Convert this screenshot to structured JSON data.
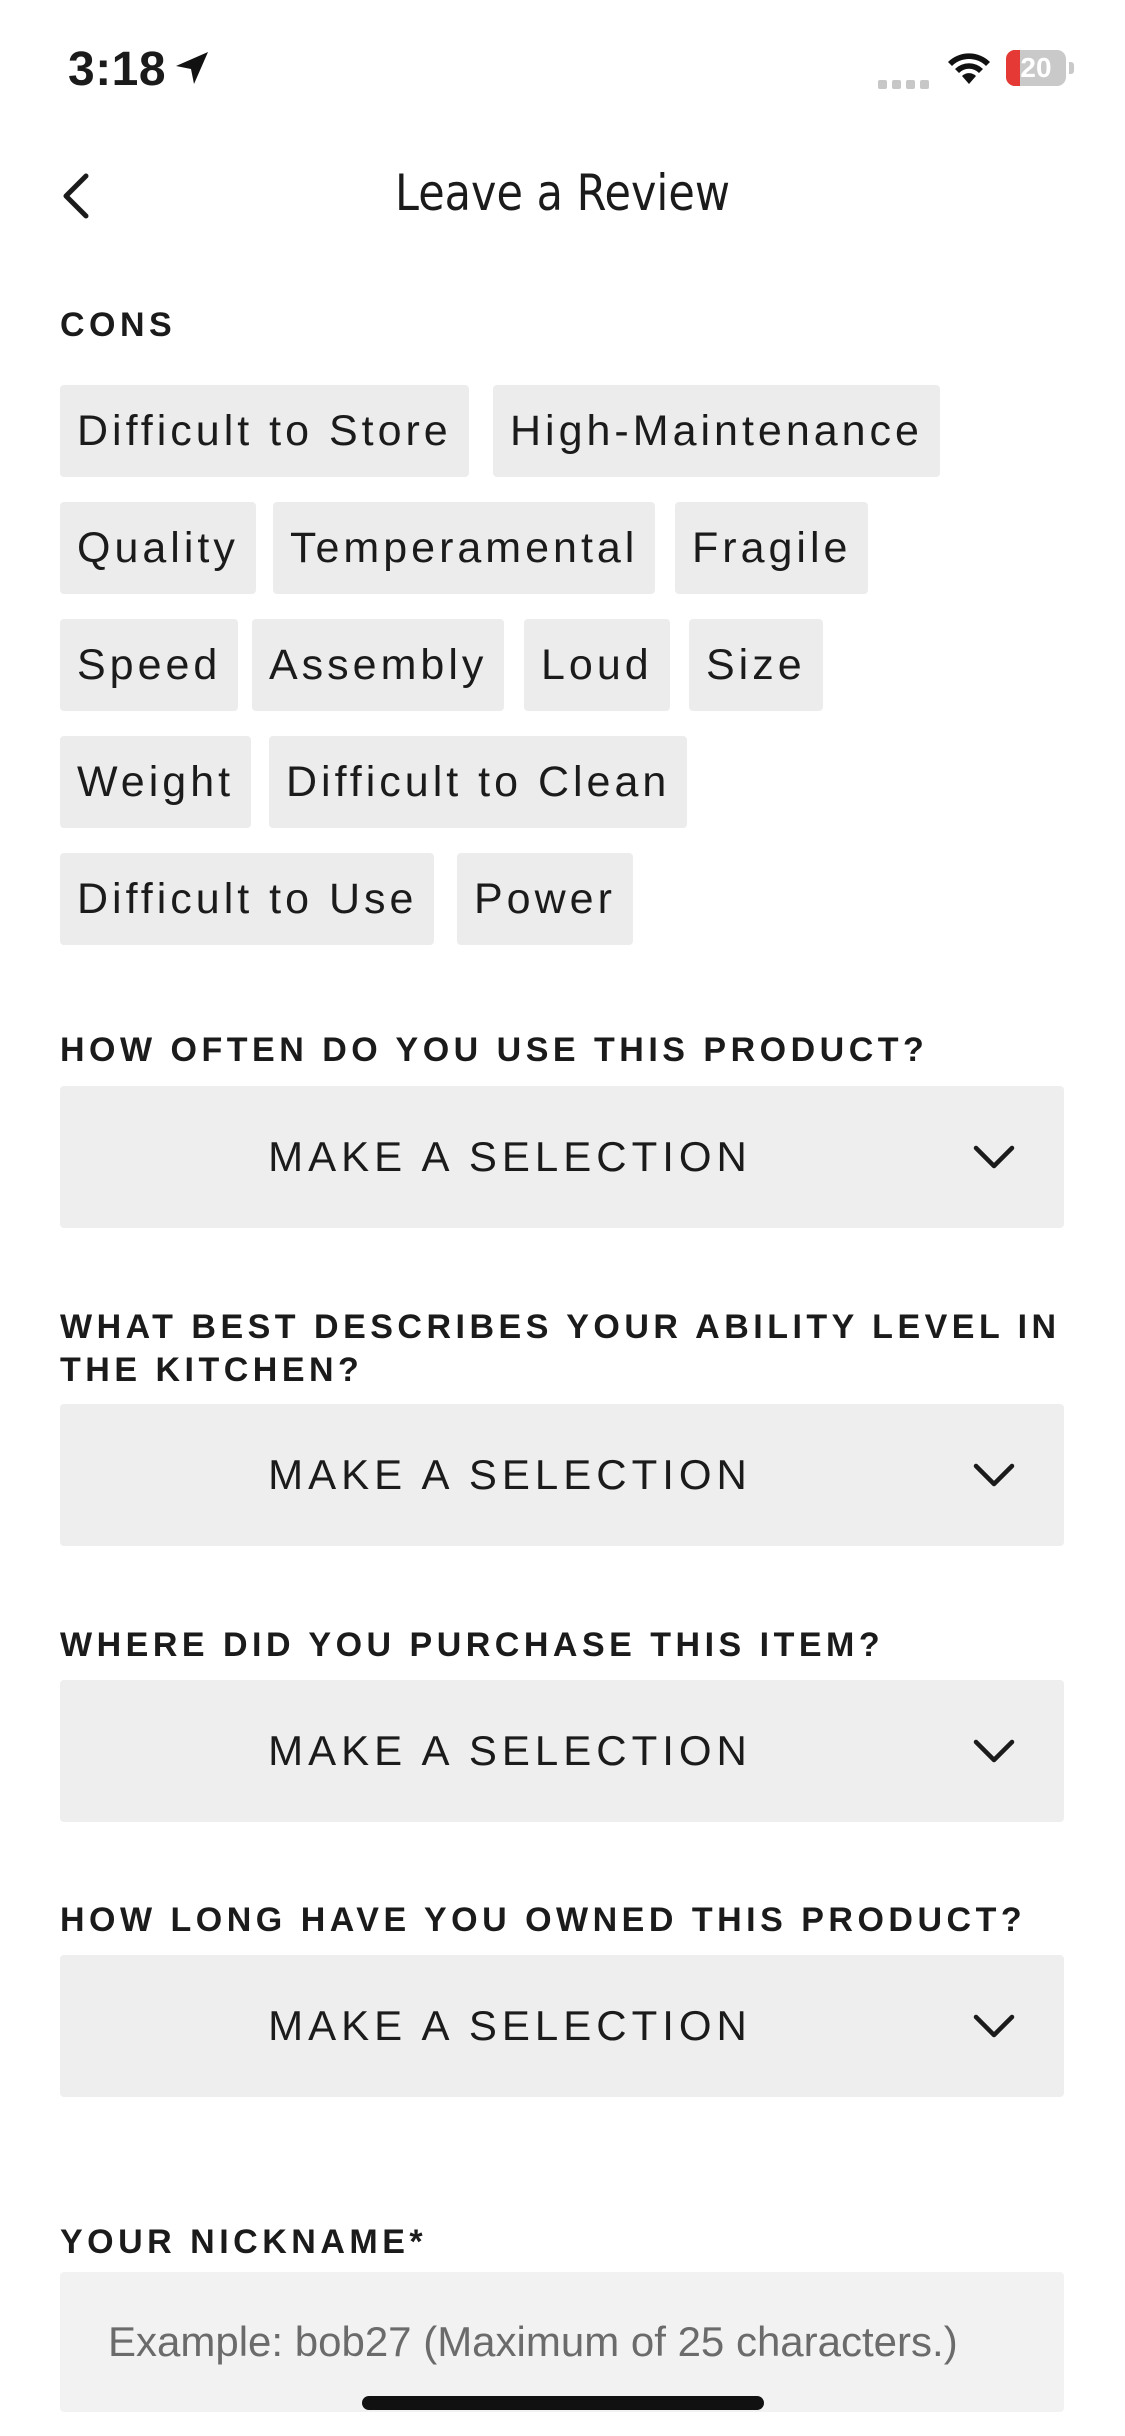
{
  "status_bar": {
    "time": "3:18",
    "battery": "20"
  },
  "header": {
    "title": "Leave a Review"
  },
  "cons": {
    "label": "CONS",
    "chips": [
      "Difficult to Store",
      "High-Maintenance",
      "Quality",
      "Temperamental",
      "Fragile",
      "Speed",
      "Assembly",
      "Loud",
      "Size",
      "Weight",
      "Difficult to Clean",
      "Difficult to Use",
      "Power"
    ]
  },
  "questions": [
    {
      "label": "HOW OFTEN DO YOU USE THIS PRODUCT?",
      "value": "MAKE A SELECTION"
    },
    {
      "label_line1": "WHAT BEST DESCRIBES YOUR ABILITY LEVEL IN",
      "label_line2": "THE KITCHEN?",
      "value": "MAKE A SELECTION"
    },
    {
      "label": "WHERE DID YOU PURCHASE THIS ITEM?",
      "value": "MAKE A SELECTION"
    },
    {
      "label": "HOW LONG HAVE YOU OWNED THIS PRODUCT?",
      "value": "MAKE A SELECTION"
    }
  ],
  "nickname": {
    "label": "YOUR NICKNAME*",
    "placeholder": "Example: bob27 (Maximum of 25 characters.)"
  }
}
